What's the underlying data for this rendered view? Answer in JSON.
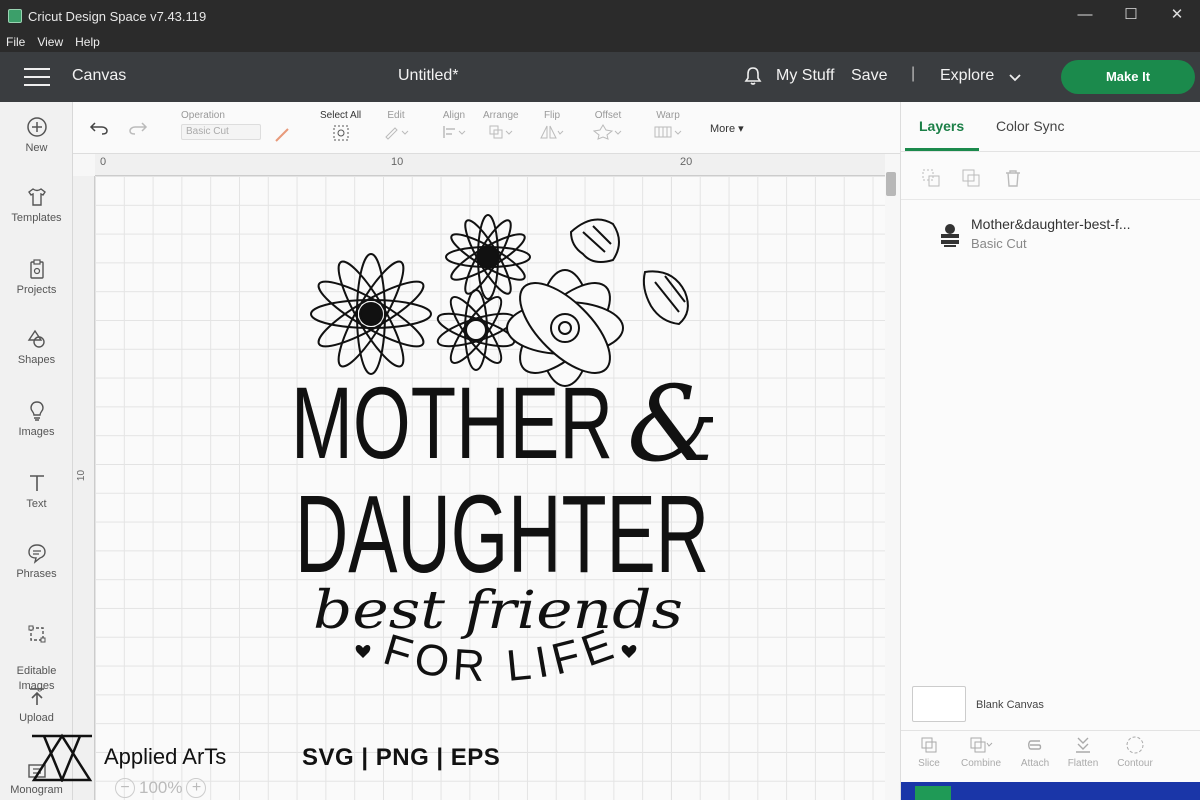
{
  "window": {
    "title": "Cricut Design Space  v7.43.119",
    "minimize": "—",
    "maximize": "☐",
    "close": "✕"
  },
  "menubar": [
    "File",
    "View",
    "Help"
  ],
  "header": {
    "canvas_label": "Canvas",
    "doc_title": "Untitled*",
    "my_stuff": "My Stuff",
    "save": "Save",
    "separator": "|",
    "explore": "Explore",
    "make_it": "Make It",
    "accent_color": "#1b8a4c"
  },
  "sidebar": [
    {
      "label": "New",
      "icon": "plus-circle-icon"
    },
    {
      "label": "Templates",
      "icon": "tshirt-icon"
    },
    {
      "label": "Projects",
      "icon": "clipboard-icon"
    },
    {
      "label": "Shapes",
      "icon": "shapes-icon"
    },
    {
      "label": "Images",
      "icon": "lightbulb-icon"
    },
    {
      "label": "Text",
      "icon": "text-icon"
    },
    {
      "label": "Phrases",
      "icon": "speech-bubble-icon"
    },
    {
      "label": "Editable\nImages",
      "icon": "editable-images-icon"
    },
    {
      "label": "Upload",
      "icon": "upload-icon"
    },
    {
      "label": "Monogram",
      "icon": "monogram-icon"
    }
  ],
  "toolbar": {
    "operation_label": "Operation",
    "operation_value": "Basic Cut",
    "select_all": "Select All",
    "edit": "Edit",
    "align": "Align",
    "arrange": "Arrange",
    "flip": "Flip",
    "offset": "Offset",
    "warp": "Warp",
    "more": "More"
  },
  "canvas": {
    "ruler_top": [
      "0",
      "10",
      "20"
    ],
    "ruler_left": [
      "10"
    ],
    "zoom_minus": "−",
    "zoom": "100%",
    "zoom_plus": "+"
  },
  "design": {
    "line1": "MOTHER",
    "amp": "&",
    "line2": "DAUGHTER",
    "line3": "best friends",
    "line4": "FOR LIFE"
  },
  "right_panel": {
    "tabs": [
      "Layers",
      "Color Sync"
    ],
    "layer_name": "Mother&daughter-best-f...",
    "layer_op": "Basic Cut",
    "blank_canvas": "Blank Canvas",
    "tools": [
      "Slice",
      "Combine",
      "Attach",
      "Flatten",
      "Contour"
    ]
  },
  "watermark": {
    "brand": "Applied ArTs",
    "formats": "SVG | PNG | EPS"
  }
}
